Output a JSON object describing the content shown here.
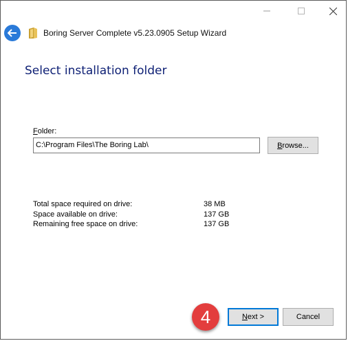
{
  "window": {
    "title": "Boring Server Complete v5.23.0905 Setup Wizard",
    "controls": {
      "minimize": "—",
      "maximize": "☐",
      "close": "✕"
    }
  },
  "icons": {
    "back": "back-arrow-icon",
    "app": "folder-icon"
  },
  "page": {
    "heading": "Select installation folder"
  },
  "folder": {
    "label_accel": "F",
    "label_rest": "older:",
    "path": "C:\\Program Files\\The Boring Lab\\"
  },
  "browse_button": {
    "accel": "B",
    "rest": "rowse..."
  },
  "space_info": [
    {
      "label": "Total space required on drive:",
      "value": "38 MB"
    },
    {
      "label": "Space available on drive:",
      "value": "137 GB"
    },
    {
      "label": "Remaining free space on drive:",
      "value": "137 GB"
    }
  ],
  "buttons": {
    "next_accel": "N",
    "next_rest": "ext >",
    "cancel": "Cancel"
  },
  "annotation": {
    "step_number": "4"
  },
  "colors": {
    "heading": "#0d1f74",
    "back_button": "#2a7ad9",
    "default_button_border": "#0078d7",
    "badge": "#e33d3d"
  }
}
